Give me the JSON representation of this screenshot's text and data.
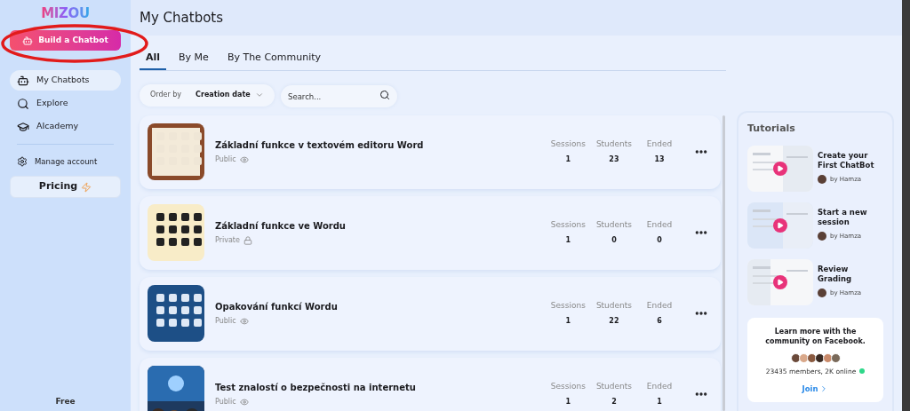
{
  "sidebar": {
    "logo": "MIZOU",
    "build_button": "Build a Chatbot",
    "highlighted": true,
    "items": [
      {
        "label": "My Chatbots",
        "kind": "bot",
        "selected": true
      },
      {
        "label": "Explore",
        "kind": "search",
        "selected": false
      },
      {
        "label": "AIcademy",
        "kind": "cap",
        "selected": false
      }
    ],
    "account": {
      "label": "Manage account"
    },
    "pricing": "Pricing",
    "plan": "Free"
  },
  "header": {
    "title": "My Chatbots"
  },
  "tabs": [
    {
      "label": "All",
      "selected": true
    },
    {
      "label": "By Me",
      "selected": false
    },
    {
      "label": "By The Community",
      "selected": false
    }
  ],
  "order": {
    "label": "Order by",
    "value": "Creation date"
  },
  "search": {
    "placeholder": "Search..."
  },
  "chatbots": [
    {
      "title": "Základní funkce v textovém editoru Word",
      "visibility": "Public",
      "kind": "public",
      "stats": [
        {
          "label": "Sessions",
          "value": "1"
        },
        {
          "label": "Students",
          "value": "23"
        },
        {
          "label": "Ended",
          "value": "13"
        }
      ]
    },
    {
      "title": "Základní funkce ve Wordu",
      "visibility": "Private",
      "kind": "private",
      "stats": [
        {
          "label": "Sessions",
          "value": "1"
        },
        {
          "label": "Students",
          "value": "0"
        },
        {
          "label": "Ended",
          "value": "0"
        }
      ]
    },
    {
      "title": "Opakování funkcí Wordu",
      "visibility": "Public",
      "kind": "public",
      "stats": [
        {
          "label": "Sessions",
          "value": "1"
        },
        {
          "label": "Students",
          "value": "22"
        },
        {
          "label": "Ended",
          "value": "6"
        }
      ]
    },
    {
      "title": "Test znalostí o bezpečnosti na internetu",
      "visibility": "Public",
      "kind": "public",
      "stats": [
        {
          "label": "Sessions",
          "value": "1"
        },
        {
          "label": "Students",
          "value": "2"
        },
        {
          "label": "Ended",
          "value": "1"
        }
      ]
    }
  ],
  "tutorials": {
    "title": "Tutorials",
    "items": [
      {
        "title": "Create your First ChatBot",
        "author": "by Hamza"
      },
      {
        "title": "Start a new session",
        "author": "by Hamza"
      },
      {
        "title": "Review Grading",
        "author": "by Hamza"
      }
    ]
  },
  "community": {
    "text": "Learn more with the community on Facebook.",
    "members": "23435 members, 2K online",
    "online": true,
    "join": "Join"
  }
}
